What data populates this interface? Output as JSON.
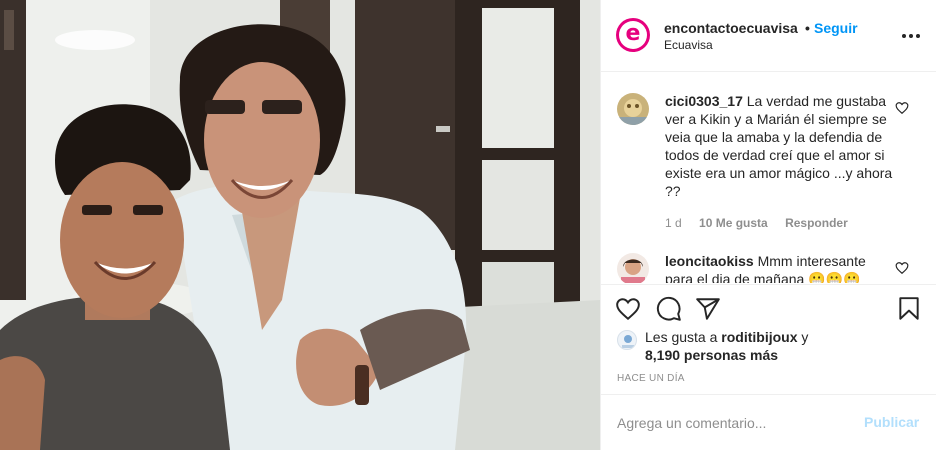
{
  "header": {
    "username": "encontactoecuavisa",
    "separator": "•",
    "follow_label": "Seguir",
    "subtitle": "Ecuavisa",
    "avatar_letter": "e",
    "more_icon": "more-horizontal-icon"
  },
  "comments": [
    {
      "username": "cici0303_17",
      "text": "La verdad me gustaba ver a Kikin y a Marián él siempre se veia que la amaba y la defendia de todos de verdad creí que el amor si existe era un amor mágico ...y ahora ??",
      "time": "1 d",
      "likes": "10 Me gusta",
      "reply_label": "Responder"
    },
    {
      "username": "leoncitaokiss",
      "text": "Mmm interesante para el dia de mañana 😬😬😬",
      "time": "",
      "likes": "",
      "reply_label": ""
    }
  ],
  "actions": {
    "like_icon": "heart-icon",
    "comment_icon": "comment-icon",
    "share_icon": "share-icon",
    "save_icon": "bookmark-icon"
  },
  "likes": {
    "prefix": "Les gusta a",
    "user": "roditibijoux",
    "conjunction": "y",
    "count": "8,190 personas más"
  },
  "time_ago": "HACE UN DÍA",
  "add_comment": {
    "placeholder": "Agrega un comentario...",
    "publish_label": "Publicar"
  },
  "colors": {
    "brand": "#e6007e",
    "link": "#0095f6",
    "publish_disabled": "#b2dffc",
    "muted": "#8e8e8e",
    "text": "#262626"
  }
}
